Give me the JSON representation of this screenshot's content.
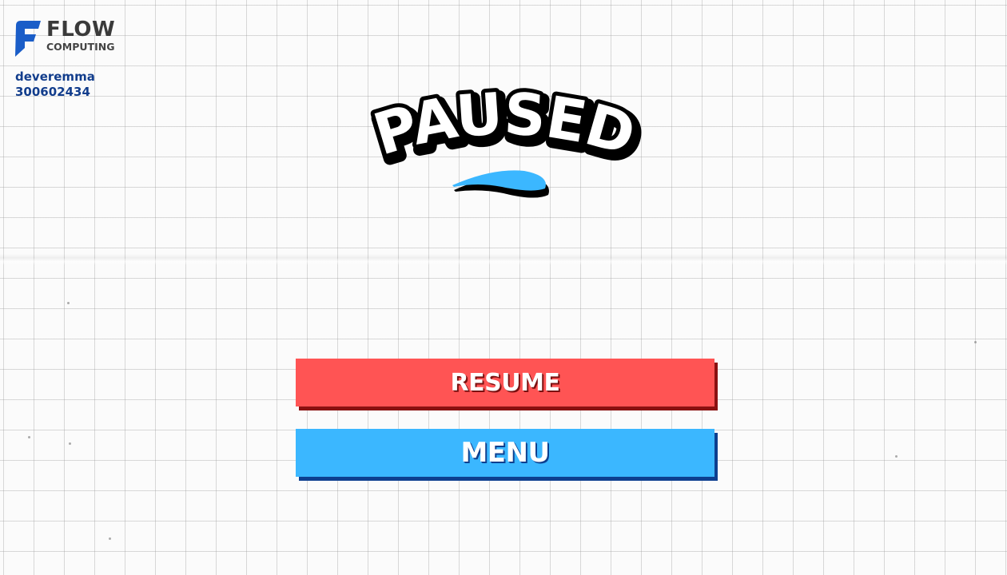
{
  "logo": {
    "word1": "FLOW",
    "word2": "COMPUTING",
    "icon": "flow-f-icon",
    "color": "#1a5dc8"
  },
  "player": {
    "username": "deveremma",
    "id": "300602434"
  },
  "title": {
    "text": "PAUSED",
    "swoosh_color": "#3bb7ff"
  },
  "buttons": {
    "resume_label": "RESUME",
    "menu_label": "MENU"
  },
  "colors": {
    "resume": "#ff5454",
    "resume_shadow": "#8a1111",
    "menu": "#3bb7ff",
    "menu_shadow": "#0d3f8f"
  }
}
